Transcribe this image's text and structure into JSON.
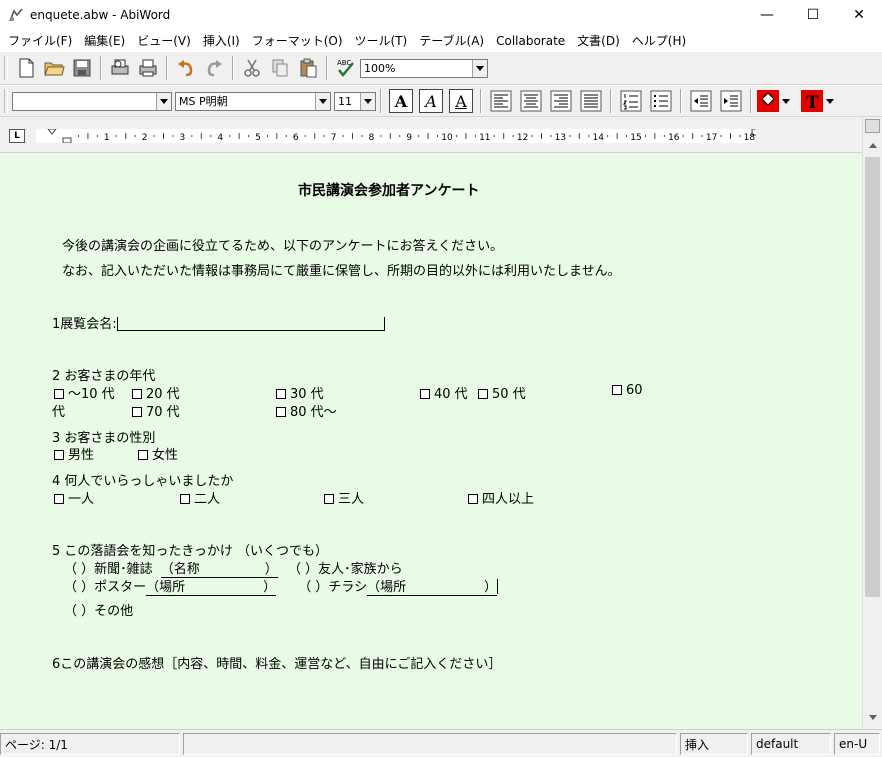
{
  "window": {
    "title": "enquete.abw - AbiWord",
    "minimize": "—",
    "maximize": "☐",
    "close": "✕"
  },
  "menu": [
    "ファイル(F)",
    "編集(E)",
    "ビュー(V)",
    "挿入(I)",
    "フォーマット(O)",
    "ツール(T)",
    "テーブル(A)",
    "Collaborate",
    "文書(D)",
    "ヘルプ(H)"
  ],
  "toolbar": {
    "zoom": "100%",
    "style": "",
    "font": "MS P明朝",
    "size": "11",
    "bold": "A",
    "italic": "A",
    "underline": "A",
    "abc": "ABC",
    "text_color_glyph": "T"
  },
  "ruler": {
    "tab_selector": "L",
    "labels": [
      "1",
      "2",
      "3",
      "4",
      "5",
      "6",
      "7",
      "8",
      "9",
      "10",
      "11",
      "12",
      "13",
      "14",
      "15",
      "16",
      "17",
      "18"
    ]
  },
  "document": {
    "title": "市民講演会参加者アンケート",
    "intro1": "今後の講演会の企画に役立てるため、以下のアンケートにお答えください。",
    "intro2": "なお、記入いただいた情報は事務局にて厳重に保管し、所期の目的以外には利用いたしません。",
    "q1": "1展覧会名:",
    "q2": "2 お客さまの年代",
    "q2_opts": [
      "～10 代",
      "20 代",
      "30 代",
      "40 代",
      "50 代",
      "60",
      "代",
      "70 代",
      "80 代～"
    ],
    "q3": "3 お客さまの性別",
    "q3_opts": [
      "男性",
      "女性"
    ],
    "q4": "4 何人でいらっしゃいましたか",
    "q4_opts": [
      "一人",
      "二人",
      "三人",
      "四人以上"
    ],
    "q5": "5 この落語会を知ったきっかけ （いくつでも）",
    "q5_l1a": "（ ）新聞･雑誌",
    "q5_l1b": "（名称　　　　　）",
    "q5_l1c": "（ ）友人･家族から",
    "q5_l2a": "（ ）ポスター",
    "q5_l2b": "（場所　　　　　　）",
    "q5_l2c": "（ ）チラシ",
    "q5_l2d": "（場所　　　　　　）",
    "q5_l3": "（ ）その他",
    "q6": "6この講演会の感想［内容、時間、料金、運営など、自由にご記入ください］"
  },
  "status": {
    "page": "ページ: 1/1",
    "mode": "挿入",
    "style": "default",
    "lang": "en-U"
  }
}
